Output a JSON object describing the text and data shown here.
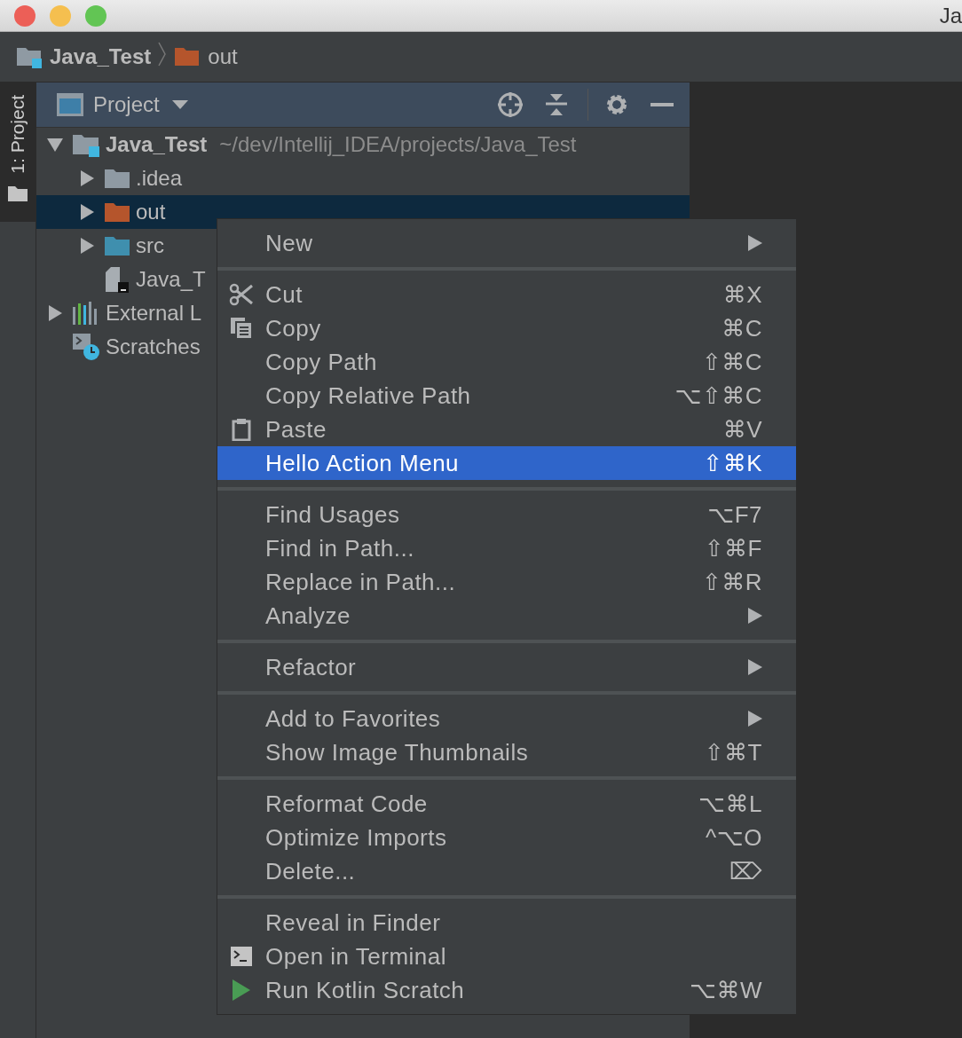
{
  "window": {
    "title": "Ja"
  },
  "breadcrumb": [
    {
      "label": "Java_Test",
      "kind": "project"
    },
    {
      "label": "out",
      "kind": "excluded"
    }
  ],
  "tool_strip": {
    "tab": {
      "label": "1: Project",
      "selected": true
    }
  },
  "project_panel": {
    "title": "Project",
    "tree": [
      {
        "label": "Java_Test",
        "path": "~/dev/Intellij_IDEA/projects/Java_Test",
        "kind": "project",
        "expanded": true,
        "selected": false,
        "children": [
          {
            "label": ".idea",
            "kind": "folder",
            "expanded": false,
            "selected": false
          },
          {
            "label": "out",
            "kind": "excluded",
            "expanded": false,
            "selected": true
          },
          {
            "label": "src",
            "kind": "source",
            "expanded": false,
            "selected": false
          },
          {
            "label": "Java_T",
            "kind": "file",
            "selected": false
          }
        ]
      },
      {
        "label": "External L",
        "kind": "libraries",
        "expanded": false,
        "selected": false
      },
      {
        "label": "Scratches",
        "kind": "scratches",
        "selected": false
      }
    ]
  },
  "context_menu": {
    "groups": [
      [
        {
          "label": "New",
          "submenu": true,
          "selected": false
        }
      ],
      [
        {
          "label": "Cut",
          "shortcut": "⌘X",
          "selected": false
        },
        {
          "label": "Copy",
          "shortcut": "⌘C",
          "selected": false
        },
        {
          "label": "Copy Path",
          "shortcut": "⇧⌘C",
          "selected": false
        },
        {
          "label": "Copy Relative Path",
          "shortcut": "⌥⇧⌘C",
          "selected": false
        },
        {
          "label": "Paste",
          "shortcut": "⌘V",
          "selected": false
        },
        {
          "label": "Hello Action Menu",
          "shortcut": "⇧⌘K",
          "selected": true
        }
      ],
      [
        {
          "label": "Find Usages",
          "shortcut": "⌥F7",
          "selected": false
        },
        {
          "label": "Find in Path...",
          "shortcut": "⇧⌘F",
          "selected": false
        },
        {
          "label": "Replace in Path...",
          "shortcut": "⇧⌘R",
          "selected": false
        },
        {
          "label": "Analyze",
          "submenu": true,
          "selected": false
        }
      ],
      [
        {
          "label": "Refactor",
          "submenu": true,
          "selected": false
        }
      ],
      [
        {
          "label": "Add to Favorites",
          "submenu": true,
          "selected": false
        },
        {
          "label": "Show Image Thumbnails",
          "shortcut": "⇧⌘T",
          "selected": false
        }
      ],
      [
        {
          "label": "Reformat Code",
          "shortcut": "⌥⌘L",
          "selected": false
        },
        {
          "label": "Optimize Imports",
          "shortcut": "^⌥O",
          "selected": false
        },
        {
          "label": "Delete...",
          "shortcut": "⌦",
          "selected": false
        }
      ],
      [
        {
          "label": "Reveal in Finder",
          "selected": false
        },
        {
          "label": "Open in Terminal",
          "selected": false
        },
        {
          "label": "Run Kotlin Scratch",
          "shortcut": "⌥⌘W",
          "selected": false
        }
      ]
    ]
  }
}
